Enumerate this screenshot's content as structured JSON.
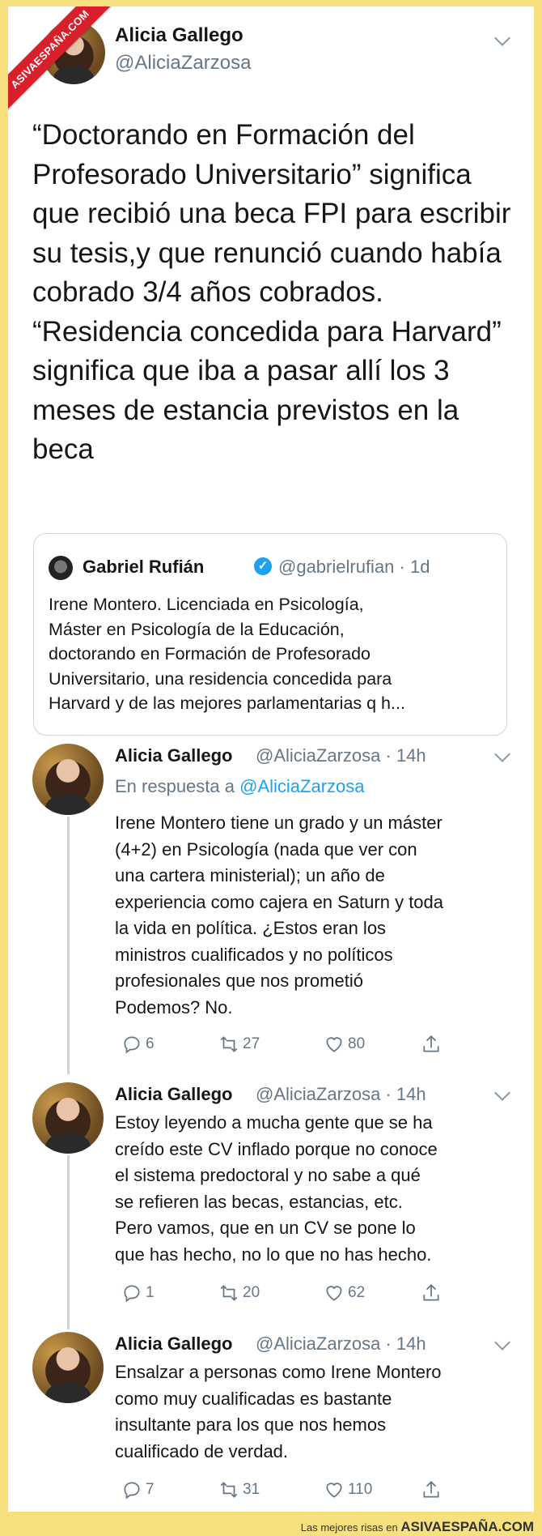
{
  "watermark": "ASIVAESPAÑA.COM",
  "main_tweet": {
    "name": "Alicia Gallego",
    "handle": "@AliciaZarzosa",
    "text": "“Doctorando en Formación del\nProfesorado Universitario” significa\nque recibió una beca FPI para escribir\nsu tesis,y que renunció cuando había\ncobrado 3/4 años cobrados.\n“Residencia concedida para Harvard”\nsignifica que iba a pasar allí los 3\nmeses de estancia previstos en la\nbeca"
  },
  "quoted_tweet": {
    "name": "Gabriel Rufián",
    "verified_mark": "✓",
    "handle_time": "@gabrielrufian · 1d",
    "text": "Irene Montero. Licenciada en Psicología,\nMáster en Psicología de la Educación,\ndoctorando en Formación de Profesorado\nUniversitario, una residencia concedida para\nHarvard y de las mejores parlamentarias q h..."
  },
  "replies": [
    {
      "name": "Alicia Gallego",
      "handle_time": "@AliciaZarzosa · 14h",
      "reply_to_prefix": "En respuesta a",
      "reply_to_handle": "@AliciaZarzosa",
      "text": "Irene Montero tiene un grado y un máster\n(4+2) en Psicología (nada que ver con\nuna cartera ministerial); un año de\nexperiencia como cajera en Saturn y toda\nla vida en política. ¿Estos eran los\nministros cualificados y no políticos\nprofesionales que nos prometió\nPodemos? No.",
      "replies": "6",
      "retweets": "27",
      "likes": "80"
    },
    {
      "name": "Alicia Gallego",
      "handle_time": "@AliciaZarzosa · 14h",
      "text": "Estoy leyendo a mucha gente que se ha\ncreído este CV inflado porque no conoce\nel sistema predoctoral y no sabe a qué\nse refieren las becas, estancias, etc.\nPero vamos, que en un CV se pone lo\nque has hecho, no lo que no has hecho.",
      "replies": "1",
      "retweets": "20",
      "likes": "62"
    },
    {
      "name": "Alicia Gallego",
      "handle_time": "@AliciaZarzosa · 14h",
      "text": "Ensalzar a personas como Irene Montero\ncomo muy cualificadas es bastante\ninsultante para los que nos hemos\ncualificado de verdad.",
      "replies": "7",
      "retweets": "31",
      "likes": "110"
    }
  ],
  "icons": {
    "reply": "reply-icon",
    "retweet": "retweet-icon",
    "like": "heart-icon",
    "share": "share-icon",
    "menu": "chevron-down-icon"
  },
  "colors": {
    "background": "#f6e17e",
    "card": "#ffffff",
    "watermark_red": "#d8202c",
    "handle_gray": "#657786",
    "link_blue": "#1da1f2"
  },
  "footer": {
    "prefix": "Las mejores risas en",
    "site": "ASIVAESPAÑA.COM"
  }
}
